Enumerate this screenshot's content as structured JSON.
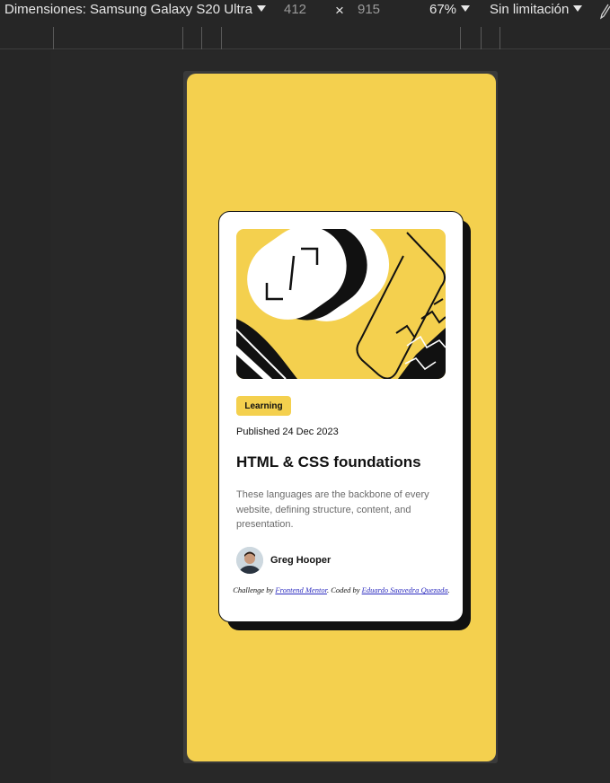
{
  "toolbar": {
    "dimensions_label": "Dimensiones: Samsung Galaxy S20 Ultra",
    "width_value": "412",
    "times_symbol": "×",
    "height_value": "915",
    "zoom_label": "67%",
    "throttle_label": "Sin limitación"
  },
  "card": {
    "tag": "Learning",
    "published": "Published 24 Dec 2023",
    "title": "HTML & CSS foundations",
    "description": "These languages are the backbone of every website, defining structure, content, and presentation.",
    "author": "Greg Hooper",
    "attribution": {
      "prefix": "Challenge by ",
      "link1": "Frontend Mentor",
      "middle": ". Coded by ",
      "link2": "Eduardo Saavedra Quezada",
      "suffix": "."
    }
  },
  "colors": {
    "accent_yellow": "#f4d04e",
    "ink": "#111111",
    "muted_text": "#6b6b6b",
    "devtools_bg": "#262626"
  }
}
